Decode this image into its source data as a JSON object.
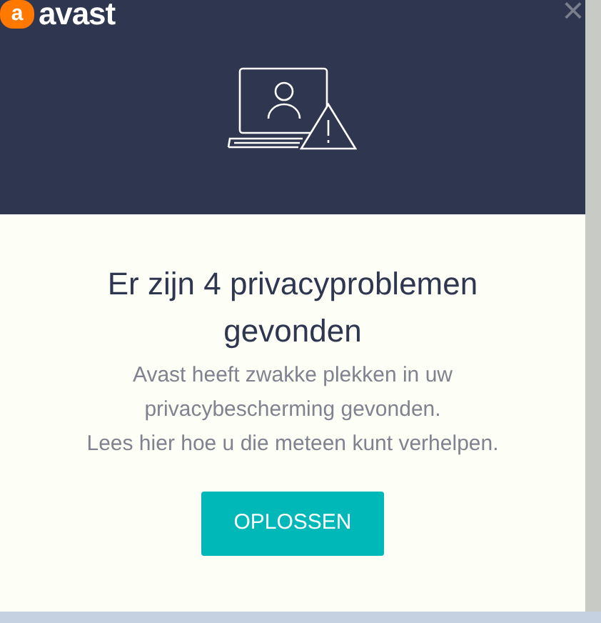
{
  "header": {
    "logo_mark": "a",
    "logo_text": "avast",
    "close": "×"
  },
  "title": "Er zijn 4 privacyproblemen gevonden",
  "message_lines": [
    "Avast heeft zwakke plekken in uw",
    "privacybescherming gevonden.",
    "Lees hier hoe u die meteen kunt verhelpen."
  ],
  "button": {
    "label": "OPLOSSEN"
  }
}
